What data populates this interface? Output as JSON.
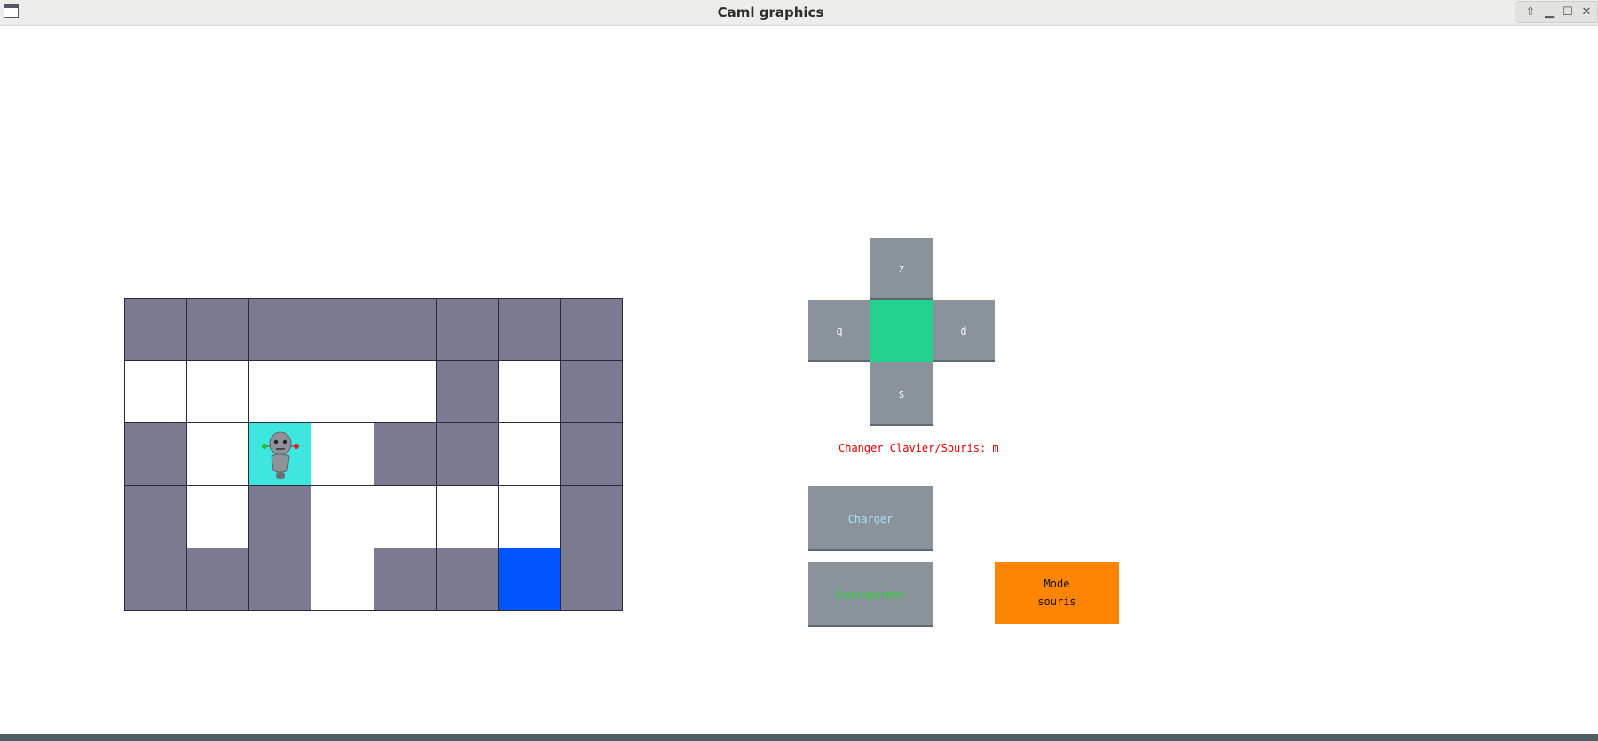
{
  "window": {
    "title": "Caml graphics",
    "controls": [
      "up-arrow-icon",
      "minimize-icon",
      "maximize-icon",
      "close-icon"
    ]
  },
  "maze": {
    "rows": [
      [
        "wall",
        "wall",
        "wall",
        "wall",
        "wall",
        "wall",
        "wall",
        "wall"
      ],
      [
        "floor",
        "floor",
        "floor",
        "floor",
        "floor",
        "wall",
        "floor",
        "wall"
      ],
      [
        "wall",
        "floor",
        "player",
        "floor",
        "wall",
        "wall",
        "floor",
        "wall"
      ],
      [
        "wall",
        "floor",
        "wall",
        "floor",
        "floor",
        "floor",
        "floor",
        "wall"
      ],
      [
        "wall",
        "wall",
        "wall",
        "floor",
        "wall",
        "wall",
        "goal",
        "wall"
      ]
    ],
    "colors": {
      "wall": "#7a7a92",
      "floor": "#ffffff",
      "player": "#3ee6e0",
      "goal": "#0055ff"
    }
  },
  "dpad": {
    "up": "z",
    "left": "q",
    "right": "d",
    "down": "s",
    "center_color": "#22d38f"
  },
  "mode_message": "Changer Clavier/Souris: m",
  "buttons": {
    "load": "Charger",
    "save": "Sauvegarder"
  },
  "mode_box": {
    "line1": "Mode",
    "line2": "souris",
    "color": "#ff8500"
  }
}
